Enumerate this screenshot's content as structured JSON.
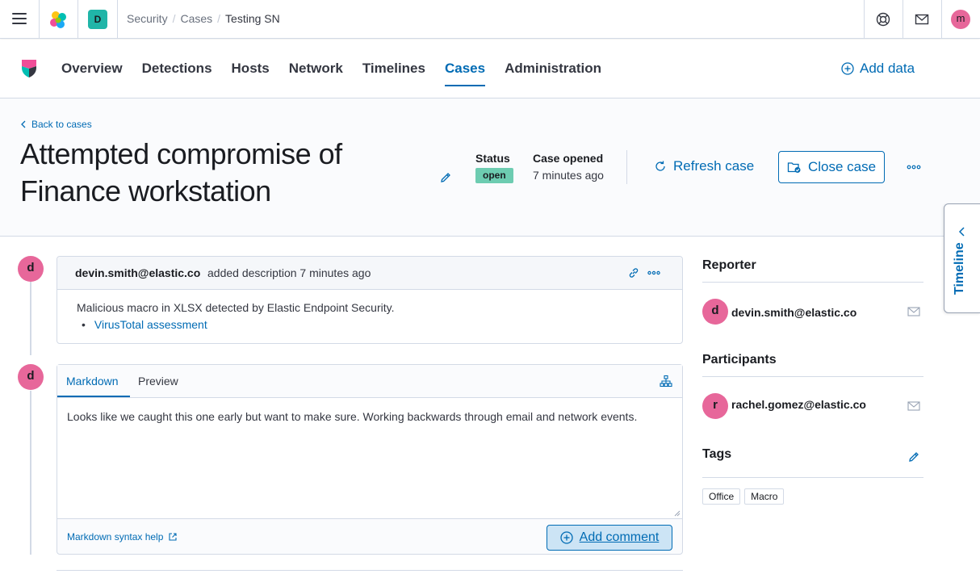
{
  "header": {
    "space_initial": "D",
    "breadcrumbs": [
      "Security",
      "Cases",
      "Testing SN"
    ],
    "user_initial": "m"
  },
  "nav": {
    "tabs": [
      "Overview",
      "Detections",
      "Hosts",
      "Network",
      "Timelines",
      "Cases",
      "Administration"
    ],
    "active_tab": "Cases",
    "add_data_label": "Add data"
  },
  "case": {
    "back_label": "Back to cases",
    "title": "Attempted compromise of Finance workstation",
    "status_label": "Status",
    "status_value": "open",
    "opened_label": "Case opened",
    "opened_value": "7 minutes ago",
    "refresh_label": "Refresh case",
    "close_label": "Close case"
  },
  "timeline_flyout": {
    "label": "Timeline"
  },
  "activity": {
    "description": {
      "avatar_initial": "d",
      "user": "devin.smith@elastic.co",
      "action": "added description 7 minutes ago",
      "body": "Malicious macro in XLSX detected by Elastic Endpoint Security.",
      "link_text": "VirusTotal assessment"
    },
    "comment": {
      "avatar_initial": "d",
      "tab_markdown": "Markdown",
      "tab_preview": "Preview",
      "text": "Looks like we caught this one early but want to make sure. Working backwards through email and network events.",
      "help_label": "Markdown syntax help",
      "submit_label": "Add comment"
    }
  },
  "sidebar": {
    "reporter_title": "Reporter",
    "reporter": {
      "initial": "d",
      "email": "devin.smith@elastic.co"
    },
    "participants_title": "Participants",
    "participants": [
      {
        "initial": "r",
        "email": "rachel.gomez@elastic.co"
      }
    ],
    "tags_title": "Tags",
    "tags": [
      "Office",
      "Macro"
    ]
  },
  "colors": {
    "accent": "#006bb4",
    "avatar": "#e7679a",
    "status_open": "#6dccb1",
    "space": "#20b5a8"
  },
  "icons": [
    "menu-icon",
    "elastic-logo-icon",
    "help-icon",
    "mail-icon",
    "security-logo-icon",
    "plus-circle-icon",
    "chevron-left-icon",
    "pencil-icon",
    "refresh-icon",
    "folder-check-icon",
    "dots-icon",
    "link-icon",
    "tools-icon",
    "external-link-icon"
  ]
}
